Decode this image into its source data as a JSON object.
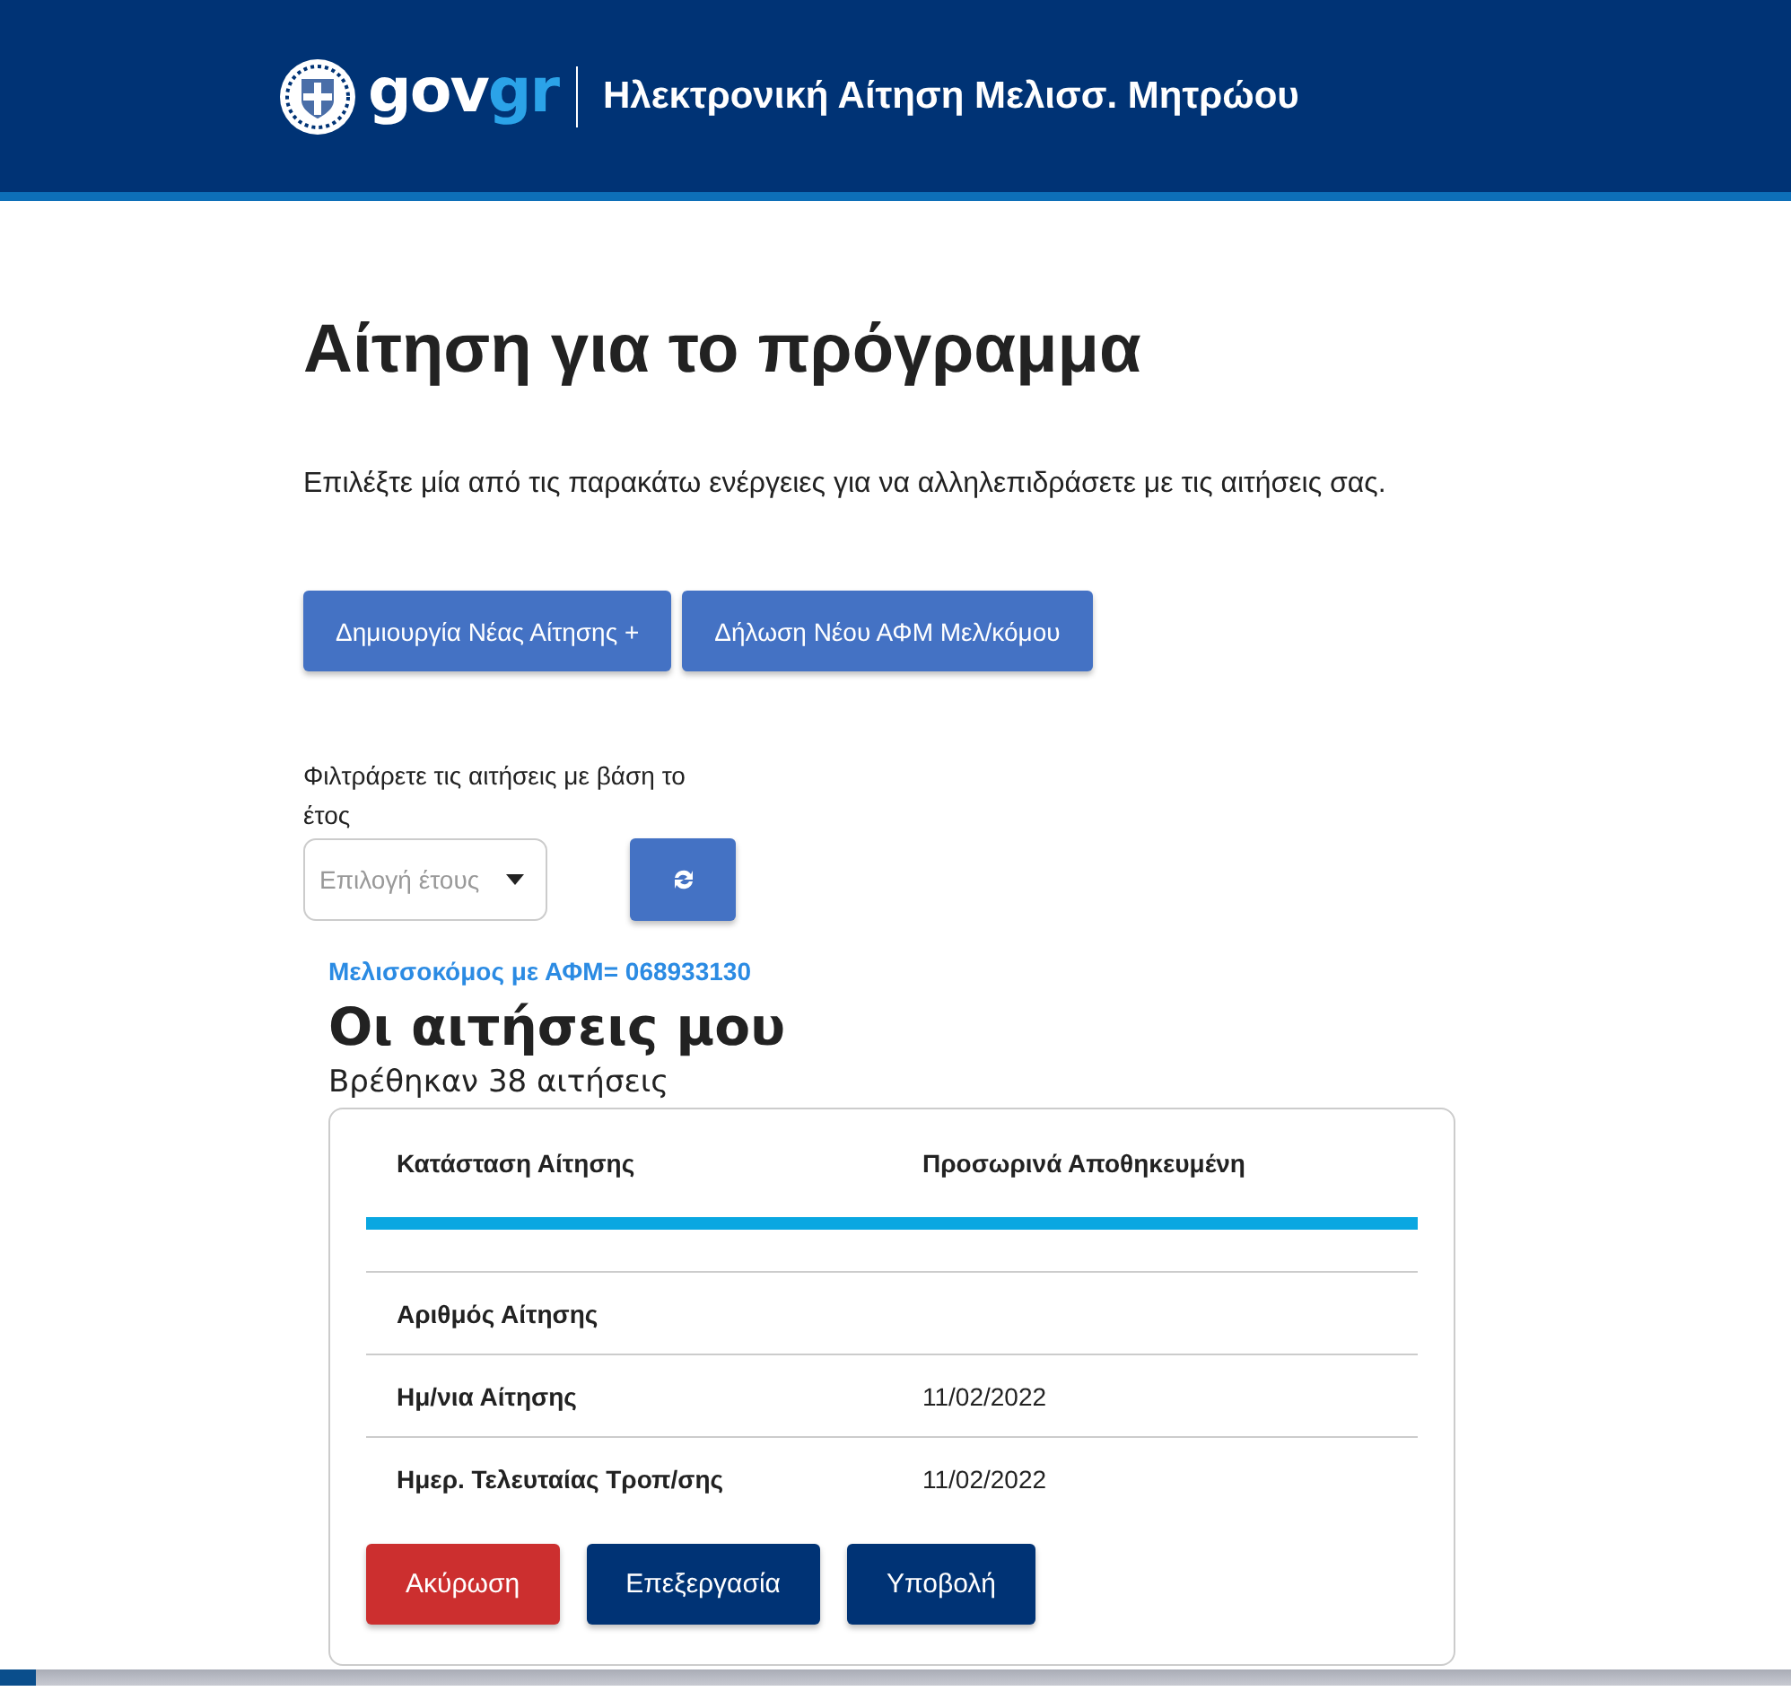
{
  "header": {
    "logo_text": "gov",
    "logo_accent": "gr",
    "title": "Ηλεκτρονική Αίτηση Μελισσ. Μητρώου"
  },
  "page": {
    "heading": "Αίτηση για το πρόγραμμα",
    "intro": "Επιλέξτε μία από τις παρακάτω ενέργειες για να αλληλεπιδράσετε με τις αιτήσεις σας.",
    "actions": [
      "Δημιουργία Νέας Αίτησης +",
      "Δήλωση Νέου ΑΦΜ Μελ/κόμου"
    ],
    "filter": {
      "label": "Φιλτράρετε τις αιτήσεις με βάση το έτος",
      "placeholder": "Επιλογή έτους"
    },
    "beekeeper": "Μελισσοκόμος με ΑΦΜ= 068933130",
    "section_title": "Οι αιτήσεις μου",
    "count": "Βρέθηκαν 38 αιτήσεις"
  },
  "card": {
    "rows": [
      {
        "label": "Κατάσταση Αίτησης",
        "value": "Προσωρινά Αποθηκευμένη",
        "kind": "status"
      },
      {
        "label": "Αριθμός Αίτησης",
        "kind": "plain"
      },
      {
        "label": "Ημ/νια Αίτησης",
        "value": "11/02/2022",
        "kind": "plain"
      },
      {
        "label": "Ημερ. Τελευταίας Τροπ/σης",
        "value": "11/02/2022",
        "kind": "plain"
      }
    ],
    "buttons": [
      {
        "label": "Ακύρωση",
        "kind": "danger"
      },
      {
        "label": "Επεξεργασία",
        "kind": "primary"
      },
      {
        "label": "Υποβολή",
        "kind": "primary"
      }
    ]
  }
}
